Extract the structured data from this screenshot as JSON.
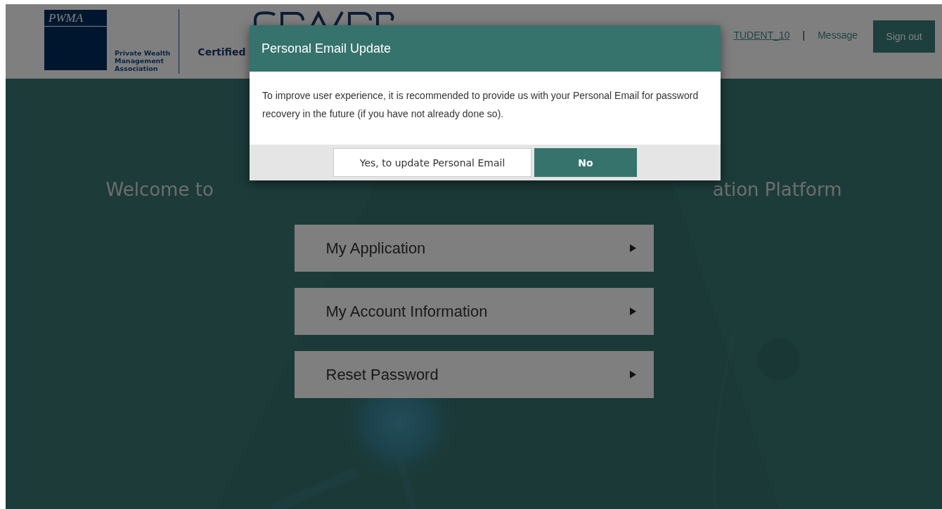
{
  "header": {
    "logo": {
      "wordmark": "PWMA",
      "tagline": [
        "Private Wealth",
        "Management",
        "Association"
      ]
    },
    "certified_text": "Certified",
    "user_link": "TUDENT_10",
    "separator": "|",
    "message_link": "Message",
    "sign_out_button": "Sign out"
  },
  "welcome": {
    "left_text": "Welcome to",
    "right_text": "ation Platform"
  },
  "menu": [
    {
      "label": "My Application"
    },
    {
      "label": "My Account Information"
    },
    {
      "label": "Reset Password"
    }
  ],
  "dialog": {
    "title": "Personal Email Update",
    "message": "To improve user experience, it is recommended to provide us with your Personal Email for password recovery in the future (if you have not already done so).",
    "buttons": [
      {
        "label": "Yes, to update Personal Email",
        "kind": "secondary"
      },
      {
        "label": "No",
        "kind": "primary"
      }
    ]
  }
}
